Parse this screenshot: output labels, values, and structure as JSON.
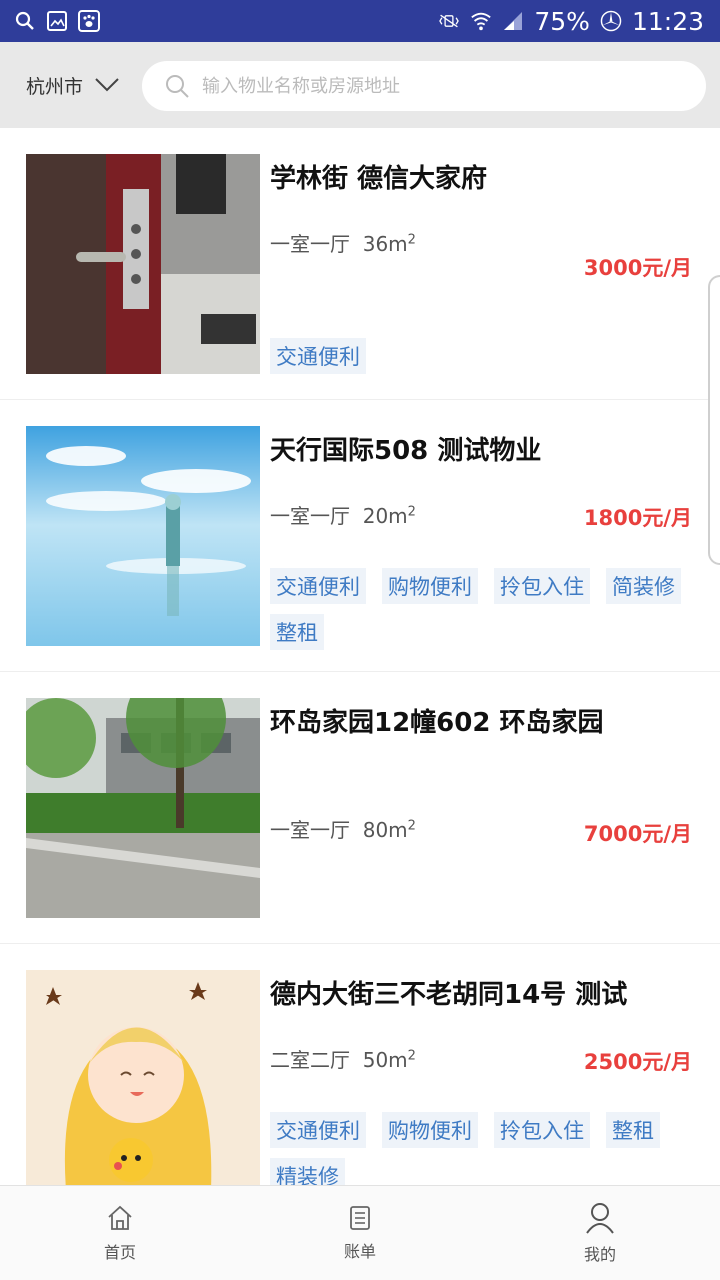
{
  "status": {
    "battery": "75%",
    "time": "11:23"
  },
  "header": {
    "city": "杭州市",
    "search_placeholder": "输入物业名称或房源地址"
  },
  "listings": [
    {
      "title": "学林街 德信大家府",
      "layout": "一室一厅",
      "area": "36m",
      "area_unit_sup": "2",
      "price": "3000元/月",
      "tags": [
        "交通便利"
      ]
    },
    {
      "title": "天行国际508 测试物业",
      "layout": "一室一厅",
      "area": "20m",
      "area_unit_sup": "2",
      "price": "1800元/月",
      "tags": [
        "交通便利",
        "购物便利",
        "拎包入住",
        "简装修",
        "整租"
      ]
    },
    {
      "title": "环岛家园12幢602 环岛家园",
      "layout": "一室一厅",
      "area": "80m",
      "area_unit_sup": "2",
      "price": "7000元/月",
      "tags": []
    },
    {
      "title": "德内大街三不老胡同14号 测试",
      "layout": "二室二厅",
      "area": "50m",
      "area_unit_sup": "2",
      "price": "2500元/月",
      "tags": [
        "交通便利",
        "购物便利",
        "拎包入住",
        "整租",
        "精装修"
      ]
    }
  ],
  "nav": {
    "home": "首页",
    "bill": "账单",
    "mine": "我的"
  },
  "colors": {
    "statusbar": "#2f3d9a",
    "price": "#e8403d",
    "tag_text": "#3f7bc4",
    "tag_bg": "#eef3f9"
  }
}
